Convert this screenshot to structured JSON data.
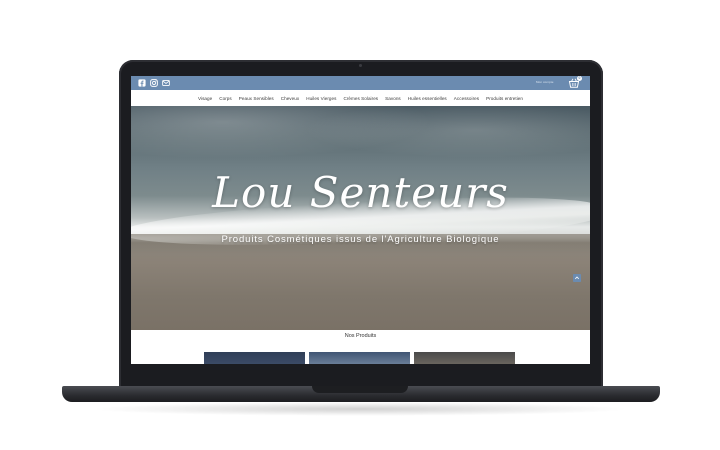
{
  "topbar": {
    "social_icons": [
      "facebook-icon",
      "instagram-icon",
      "mail-icon"
    ],
    "account_link": "Mon compte",
    "cart_icon": "basket-icon",
    "cart_count": "0"
  },
  "nav": {
    "items": [
      {
        "label": "Visage"
      },
      {
        "label": "Corps"
      },
      {
        "label": "Peaux Sensibles"
      },
      {
        "label": "Cheveux"
      },
      {
        "label": "Huiles Vierges"
      },
      {
        "label": "Crèmes Solaires"
      },
      {
        "label": "Savons"
      },
      {
        "label": "Huiles essentielles"
      },
      {
        "label": "Accessoires"
      },
      {
        "label": "Produits entretien"
      }
    ]
  },
  "hero": {
    "title": "Lou Senteurs",
    "subtitle": "Produits Cosmétiques issus de l'Agriculture Biologique",
    "scroll_icon": "scroll-icon"
  },
  "products": {
    "title": "Nos Produits"
  },
  "colors": {
    "accent": "#6b8bb0",
    "device": "#1b1c20"
  }
}
